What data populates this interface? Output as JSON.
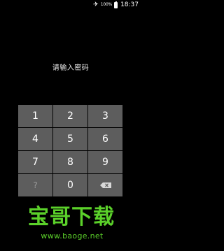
{
  "status_bar": {
    "airplane_icon": "airplane-mode-icon",
    "battery_percent": "100%",
    "battery_icon": "battery-full-icon",
    "time": "18:37"
  },
  "prompt": "请输入密码",
  "keypad": {
    "keys": [
      {
        "label": "1"
      },
      {
        "label": "2"
      },
      {
        "label": "3"
      },
      {
        "label": "4"
      },
      {
        "label": "5"
      },
      {
        "label": "6"
      },
      {
        "label": "7"
      },
      {
        "label": "8"
      },
      {
        "label": "9"
      },
      {
        "label": "?"
      },
      {
        "label": "0"
      },
      {
        "icon": "backspace-icon"
      }
    ]
  },
  "watermark": {
    "title": "宝哥下载",
    "url": "www.baoge.net"
  },
  "colors": {
    "background": "#000000",
    "key_background": "#5d5d5d",
    "key_text": "#ffffff",
    "watermark_green": "#5bd12a"
  }
}
